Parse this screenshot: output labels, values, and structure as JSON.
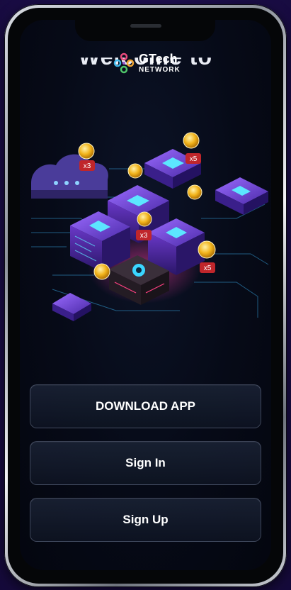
{
  "header": {
    "welcome": "Welcome to",
    "brand_name": "GTech",
    "brand_sub": "NETWORK"
  },
  "badges": [
    "x3",
    "x5",
    "x3",
    "x5"
  ],
  "buttons": {
    "download": "DOWNLOAD APP",
    "sign_in": "Sign In",
    "sign_up": "Sign Up"
  },
  "colors": {
    "background": "#1d0e4d",
    "screen": "#060a17",
    "accent_purple": "#7a3fd0",
    "accent_cyan": "#3ad6ff",
    "coin": "#f2b41c",
    "badge": "#c0262b"
  }
}
